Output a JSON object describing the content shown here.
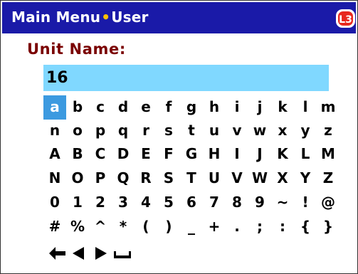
{
  "header": {
    "menu": "Main Menu",
    "separator": "•",
    "section": "User",
    "logo_text": "L3"
  },
  "form": {
    "label": "Unit Name:",
    "value": "16"
  },
  "keyboard": {
    "selected": "a",
    "rows": [
      [
        "a",
        "b",
        "c",
        "d",
        "e",
        "f",
        "g",
        "h",
        "i",
        "j",
        "k",
        "l",
        "m"
      ],
      [
        "n",
        "o",
        "p",
        "q",
        "r",
        "s",
        "t",
        "u",
        "v",
        "w",
        "x",
        "y",
        "z"
      ],
      [
        "A",
        "B",
        "C",
        "D",
        "E",
        "F",
        "G",
        "H",
        "I",
        "J",
        "K",
        "L",
        "M"
      ],
      [
        "N",
        "O",
        "P",
        "Q",
        "R",
        "S",
        "T",
        "U",
        "V",
        "W",
        "X",
        "Y",
        "Z"
      ],
      [
        "0",
        "1",
        "2",
        "3",
        "4",
        "5",
        "6",
        "7",
        "8",
        "9",
        "~",
        "!",
        "@"
      ],
      [
        "#",
        "%",
        "^",
        "*",
        "(",
        ")",
        "_",
        "+",
        ".",
        ";",
        ":",
        "{",
        "}"
      ]
    ],
    "nav_icons": [
      "backspace-arrow-icon",
      "cursor-left-icon",
      "cursor-right-icon",
      "space-icon"
    ]
  },
  "colors": {
    "title_bar": "#1a1aa8",
    "separator": "#ffc000",
    "label": "#7a0000",
    "input_bg": "#80d8ff",
    "selected_key": "#3c9ae0",
    "logo": "#e8281e"
  }
}
